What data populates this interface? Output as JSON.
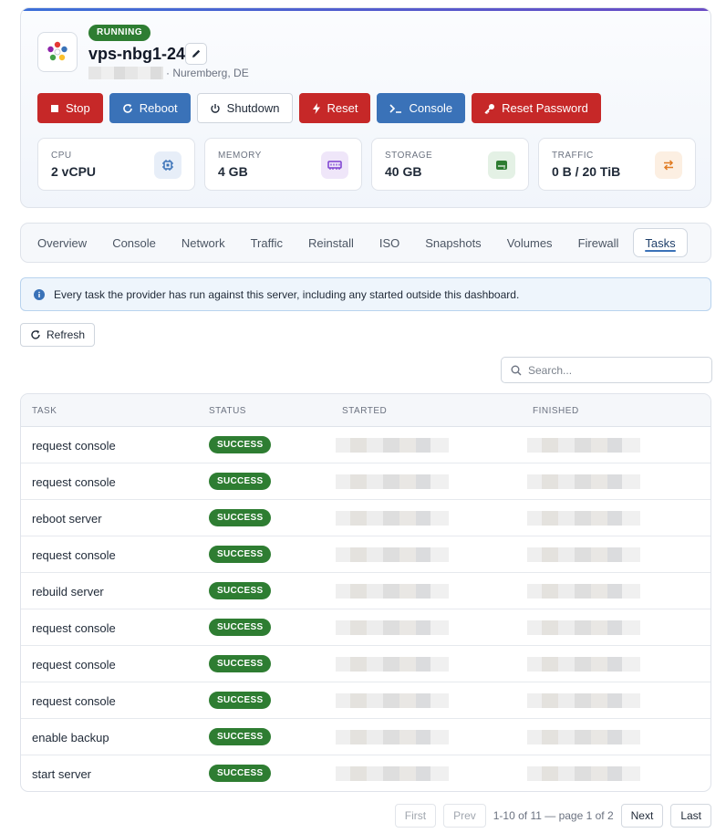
{
  "server": {
    "status": "RUNNING",
    "name": "vps-nbg1-24",
    "location": "· Nuremberg, DE"
  },
  "actions": {
    "stop": "Stop",
    "reboot": "Reboot",
    "shutdown": "Shutdown",
    "reset": "Reset",
    "console": "Console",
    "reset_password": "Reset Password"
  },
  "stats": [
    {
      "label": "CPU",
      "value": "2 vCPU",
      "icon": "cpu-chip-icon",
      "color": "#3a72b8"
    },
    {
      "label": "MEMORY",
      "value": "4 GB",
      "icon": "memory-icon",
      "color": "#7b3fd0"
    },
    {
      "label": "STORAGE",
      "value": "40 GB",
      "icon": "storage-icon",
      "color": "#2e7d32"
    },
    {
      "label": "TRAFFIC",
      "value": "0 B / 20 TiB",
      "icon": "swap-arrows-icon",
      "color": "#e07b22"
    }
  ],
  "tabs": [
    "Overview",
    "Console",
    "Network",
    "Traffic",
    "Reinstall",
    "ISO",
    "Snapshots",
    "Volumes",
    "Firewall",
    "Tasks"
  ],
  "active_tab": "Tasks",
  "info_text": "Every task the provider has run against this server, including any started outside this dashboard.",
  "refresh_label": "Refresh",
  "search": {
    "placeholder": "Search..."
  },
  "table": {
    "headers": [
      "TASK",
      "STATUS",
      "STARTED",
      "FINISHED"
    ],
    "rows": [
      {
        "task": "request console",
        "status": "SUCCESS"
      },
      {
        "task": "request console",
        "status": "SUCCESS"
      },
      {
        "task": "reboot server",
        "status": "SUCCESS"
      },
      {
        "task": "request console",
        "status": "SUCCESS"
      },
      {
        "task": "rebuild server",
        "status": "SUCCESS"
      },
      {
        "task": "request console",
        "status": "SUCCESS"
      },
      {
        "task": "request console",
        "status": "SUCCESS"
      },
      {
        "task": "request console",
        "status": "SUCCESS"
      },
      {
        "task": "enable backup",
        "status": "SUCCESS"
      },
      {
        "task": "start server",
        "status": "SUCCESS"
      }
    ]
  },
  "pagination": {
    "first": "First",
    "prev": "Prev",
    "info": "1-10 of 11 — page 1 of 2",
    "next": "Next",
    "last": "Last"
  }
}
